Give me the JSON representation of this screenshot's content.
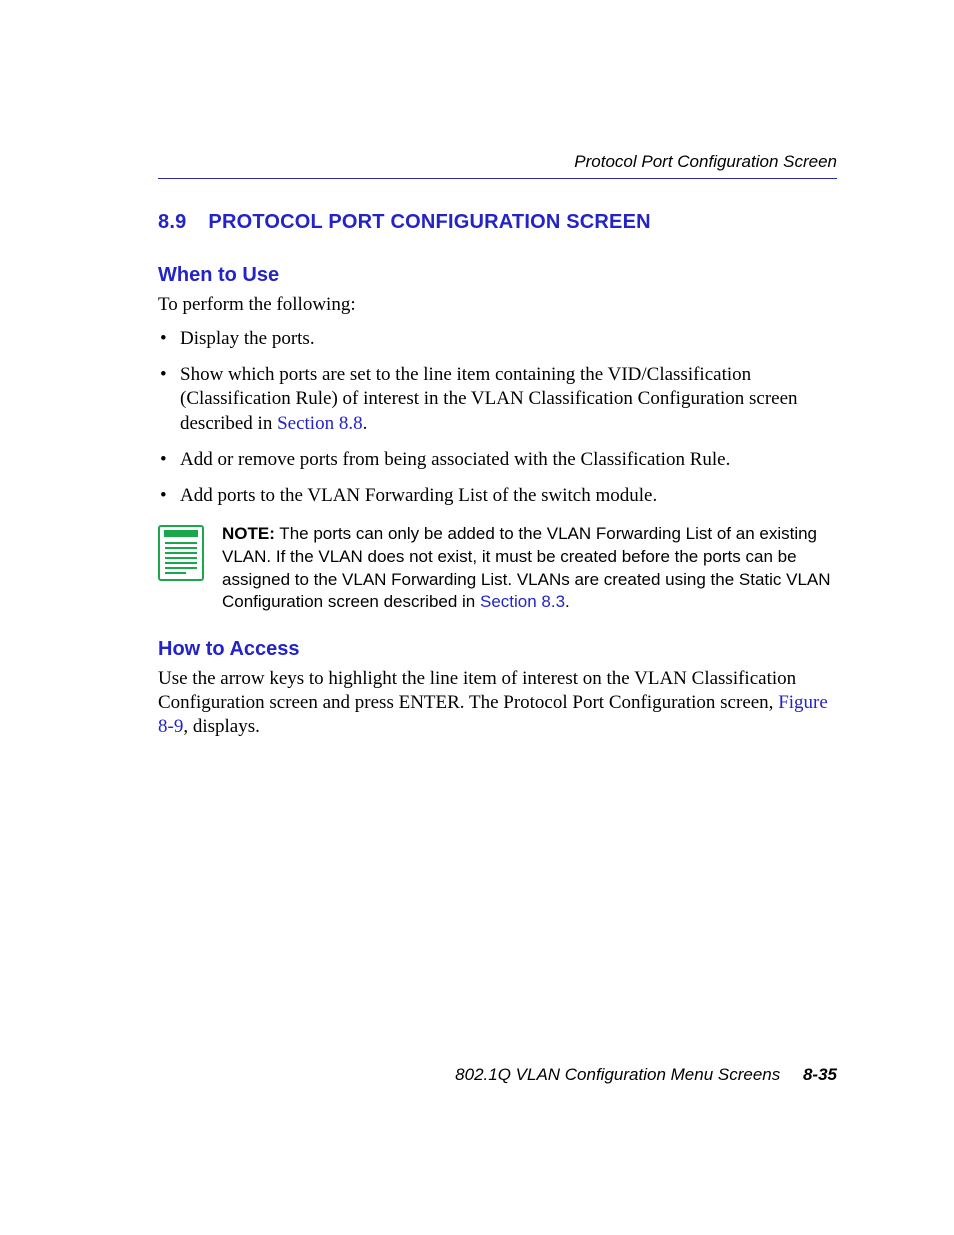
{
  "header": {
    "running_head": "Protocol Port Configuration Screen"
  },
  "section": {
    "number": "8.9",
    "title": "PROTOCOL PORT CONFIGURATION SCREEN"
  },
  "when_to_use": {
    "heading": "When to Use",
    "intro": "To perform the following:",
    "items": {
      "i0": "Display the ports.",
      "i1_a": "Show which ports are set to the line item containing the VID/Classification (Classification Rule) of interest in the VLAN Classification Configuration screen described in ",
      "i1_link": "Section 8.8",
      "i1_b": ".",
      "i2": "Add or remove ports from being associated with the Classification Rule.",
      "i3": "Add ports to the VLAN Forwarding List of the switch module."
    }
  },
  "note": {
    "label": "NOTE:",
    "body_a": "  The ports can only be added to the VLAN Forwarding List of an existing VLAN. If the VLAN does not exist, it must be created before the ports can be assigned to the VLAN Forwarding List. VLANs are created using the Static VLAN Configuration screen described in ",
    "link": "Section 8.3",
    "body_b": "."
  },
  "how_to_access": {
    "heading": "How to Access",
    "p_a": "Use the arrow keys to highlight the line item of interest on the VLAN Classification Configuration screen and press ENTER. The Protocol Port Configuration screen, ",
    "link": "Figure 8-9",
    "p_b": ", displays."
  },
  "footer": {
    "text": "802.1Q VLAN Configuration Menu Screens",
    "page": "8-35"
  }
}
